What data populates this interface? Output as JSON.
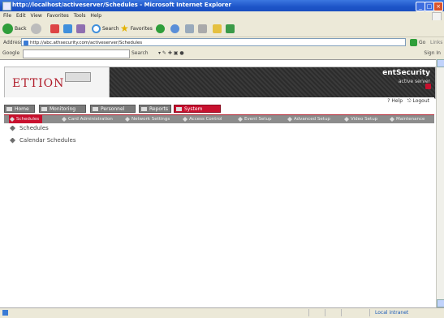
{
  "browser": {
    "title": "http://localhost/activeserver/Schedules - Microsoft Internet Explorer",
    "menu": [
      "File",
      "Edit",
      "View",
      "Favorites",
      "Tools",
      "Help"
    ],
    "toolbar": {
      "back": "Back",
      "search": "Search",
      "favorites": "Favorites"
    },
    "address_label": "Address",
    "address": "http://abc.athsecurity.com/activeserver/Schedules",
    "go_label": "Go",
    "links_label": "Links",
    "google_label": "Google",
    "google_search": "Search",
    "signin": "Sign In",
    "status_zone": "Local intranet"
  },
  "app": {
    "logo": "ETTION",
    "product": "entSecurity",
    "product_sub": "active server",
    "help": "Help",
    "logout": "Logout",
    "main_tabs": [
      {
        "label": "Home"
      },
      {
        "label": "Monitoring"
      },
      {
        "label": "Personnel"
      },
      {
        "label": "Reports"
      },
      {
        "label": "System Setup",
        "active": true
      }
    ],
    "sub_tabs": [
      {
        "label": "Schedules",
        "active": true
      },
      {
        "label": "Card Administration"
      },
      {
        "label": "Network Settings"
      },
      {
        "label": "Access Control"
      },
      {
        "label": "Event Setup"
      },
      {
        "label": "Advanced Setup"
      },
      {
        "label": "Video Setup"
      },
      {
        "label": "Maintenance"
      }
    ],
    "content_items": [
      "Schedules",
      "Calendar Schedules"
    ]
  },
  "colors": {
    "accent": "#c8102e",
    "nav_gray": "#7a7a7a",
    "xp_blue": "#1d54c8"
  }
}
